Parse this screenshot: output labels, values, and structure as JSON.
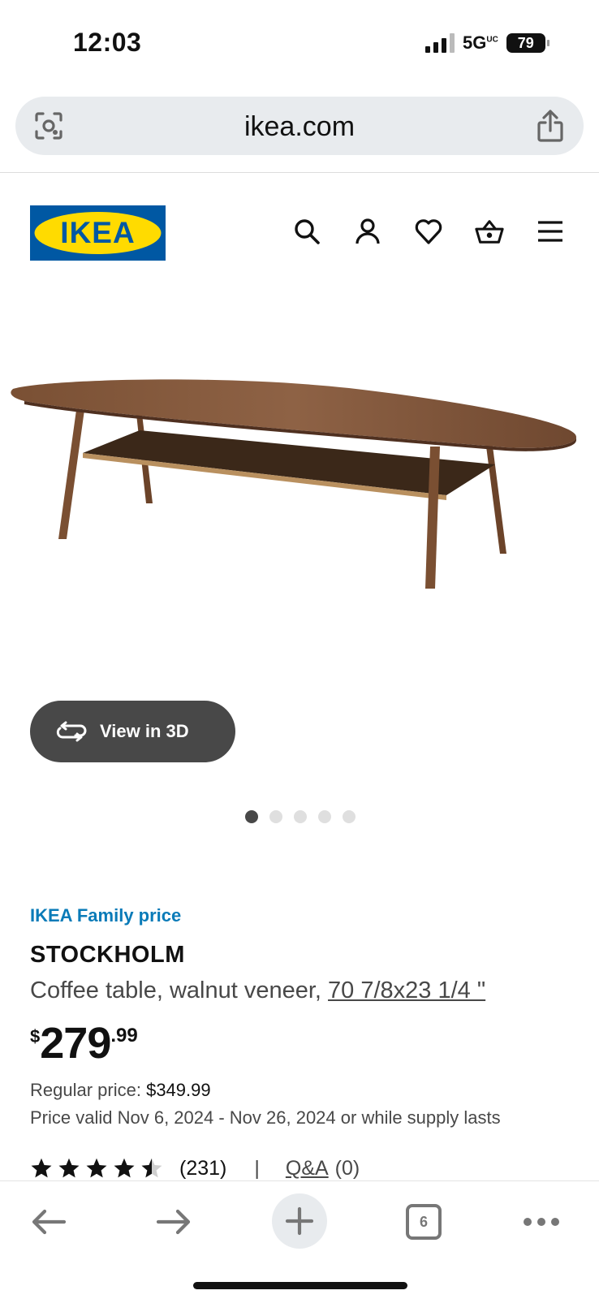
{
  "status_bar": {
    "time": "12:03",
    "network": "5G",
    "network_sup": "UC",
    "battery": "79"
  },
  "browser": {
    "url": "ikea.com",
    "lens_icon": "camera-lens-icon",
    "share_icon": "share-icon"
  },
  "header": {
    "logo_text": "IKEA",
    "colors": {
      "logo_blue": "#0058a3",
      "logo_yellow": "#ffdb00"
    },
    "icons": [
      "search-icon",
      "account-icon",
      "heart-icon",
      "basket-icon",
      "menu-icon"
    ]
  },
  "gallery": {
    "view3d_label": "View in 3D",
    "dot_count": 5,
    "active_index": 0
  },
  "product": {
    "family_price_label": "IKEA Family price",
    "name": "STOCKHOLM",
    "description": "Coffee table, walnut veneer, ",
    "dimensions": "70 7/8x23 1/4 \"",
    "price": {
      "currency": "$",
      "integer": "279",
      "decimal": ".99"
    },
    "regular_label": "Regular price: ",
    "regular_value": "$349.99",
    "validity": "Price valid Nov 6, 2024 - Nov 26, 2024 or while supply lasts",
    "rating": 4.5,
    "review_count": "(231)",
    "separator": "|",
    "qa_label": "Q&A",
    "qa_count": "(0)",
    "colors": {
      "family_blue": "#0a7bb8"
    }
  },
  "toolbar": {
    "tab_count": "6",
    "icons": [
      "back-arrow-icon",
      "forward-arrow-icon",
      "plus-icon",
      "tabs-icon",
      "more-icon"
    ]
  }
}
